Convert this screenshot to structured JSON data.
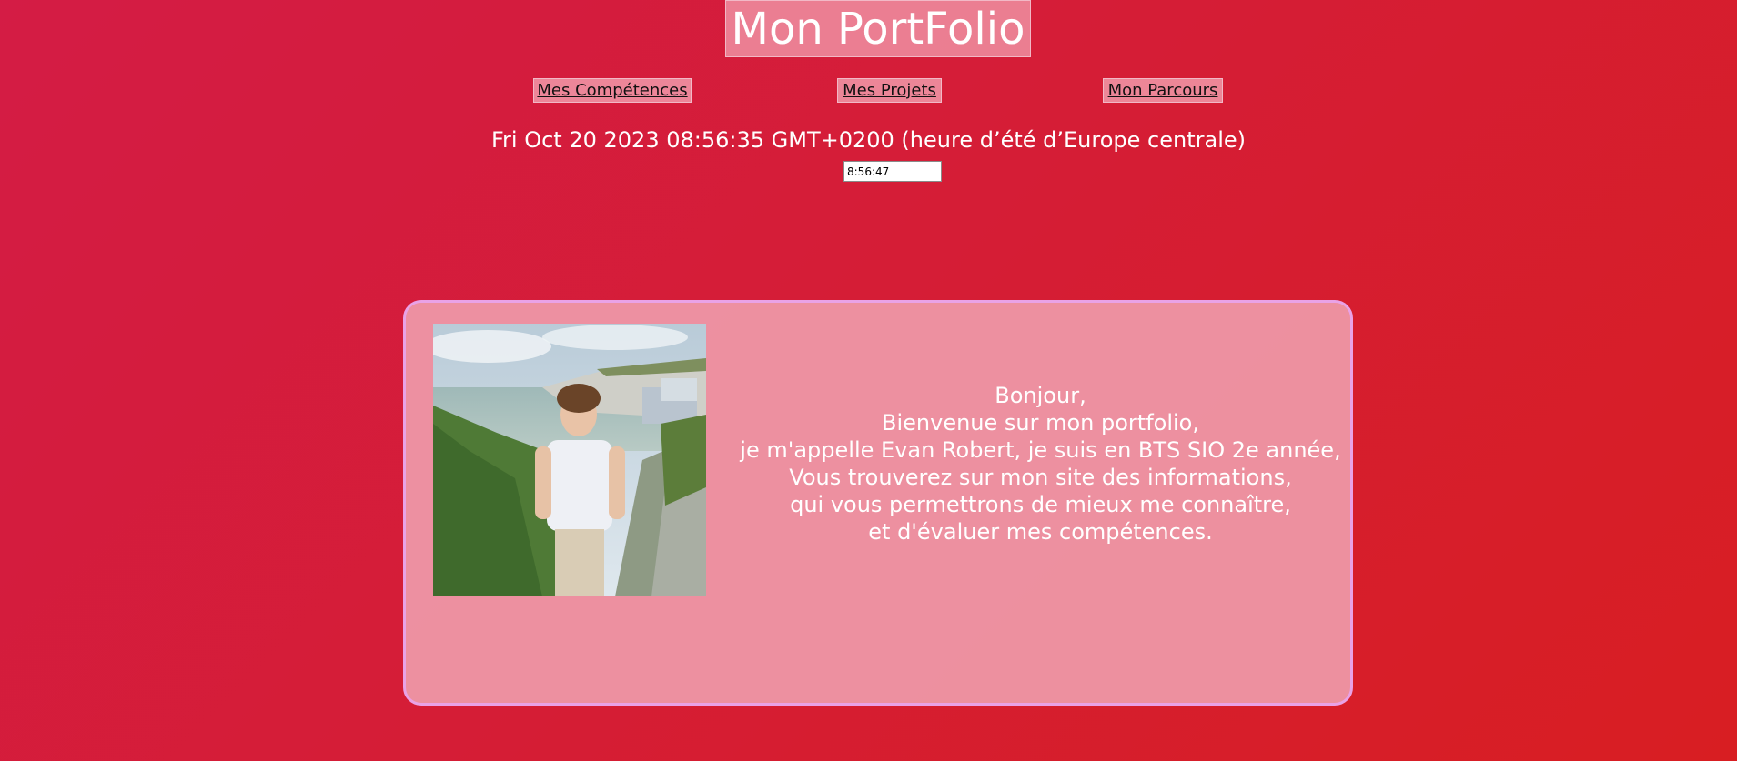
{
  "header": {
    "title": "Mon PortFolio"
  },
  "nav": {
    "items": [
      {
        "label": "Mes Compétences"
      },
      {
        "label": "Mes Projets"
      },
      {
        "label": "Mon Parcours"
      }
    ]
  },
  "date_display": "Fri Oct 20 2023 08:56:35 GMT+0200 (heure d’été d’Europe centrale)",
  "clock": {
    "value": "8:56:47"
  },
  "intro": {
    "lines": [
      "Bonjour,",
      "Bienvenue sur mon portfolio,",
      "je m'appelle Evan Robert, je suis en BTS SIO 2e année,",
      "Vous trouverez sur mon site des informations,",
      "qui vous permettrons de mieux me connaître,",
      "et d'évaluer mes compétences."
    ]
  },
  "colors": {
    "background_start": "#d41c45",
    "background_end": "#d81e22",
    "card_border": "#e9a2e6"
  }
}
